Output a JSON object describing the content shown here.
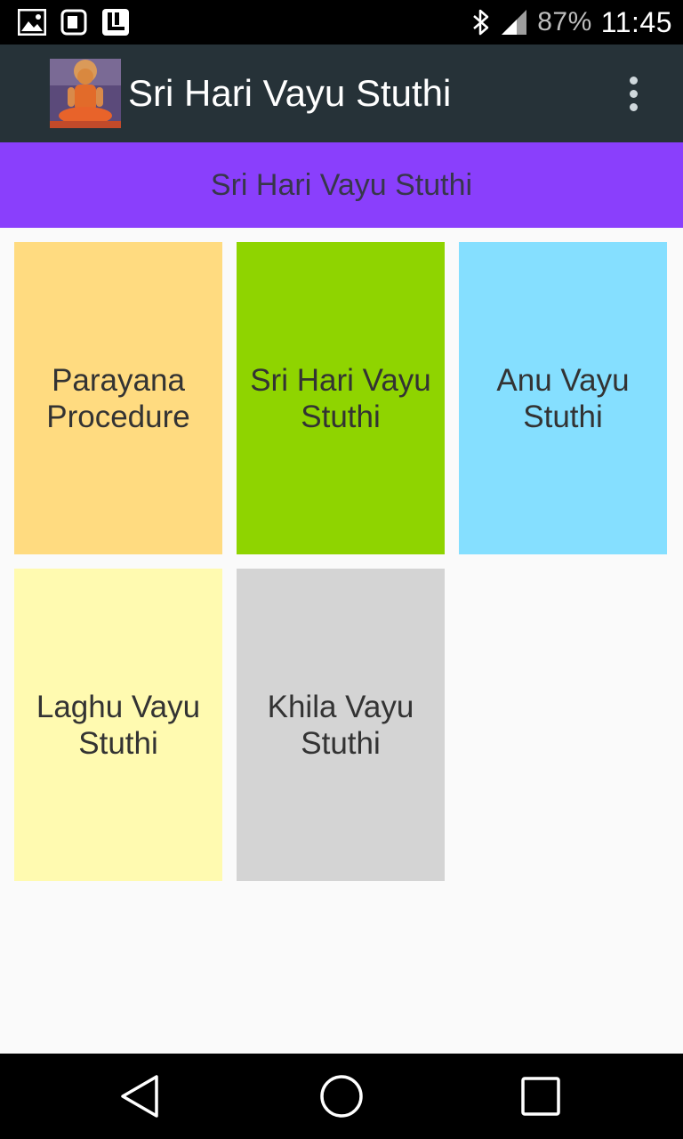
{
  "status_bar": {
    "left_icons": [
      "gallery-icon",
      "screenshot-icon",
      "storage-icon"
    ],
    "bluetooth_icon": "bluetooth-icon",
    "signal_icon": "signal-icon",
    "battery": "87%",
    "time": "11:45"
  },
  "app_bar": {
    "logo_icon": "app-logo-icon",
    "title": "Sri Hari Vayu Stuthi",
    "overflow_icon": "overflow-menu-icon"
  },
  "banner": {
    "title": "Sri Hari Vayu Stuthi",
    "color": "#8a3ffc"
  },
  "tiles": [
    {
      "label": "Parayana Procedure",
      "color": "#ffdb80"
    },
    {
      "label": "Sri Hari Vayu Stuthi",
      "color": "#8fd400"
    },
    {
      "label": "Anu Vayu Stuthi",
      "color": "#85dfff"
    },
    {
      "label": "Laghu Vayu Stuthi",
      "color": "#fffab0"
    },
    {
      "label": "Khila Vayu Stuthi",
      "color": "#d4d4d4"
    }
  ],
  "nav_bar": {
    "back_icon": "back-icon",
    "home_icon": "home-icon",
    "recents_icon": "recents-icon"
  }
}
